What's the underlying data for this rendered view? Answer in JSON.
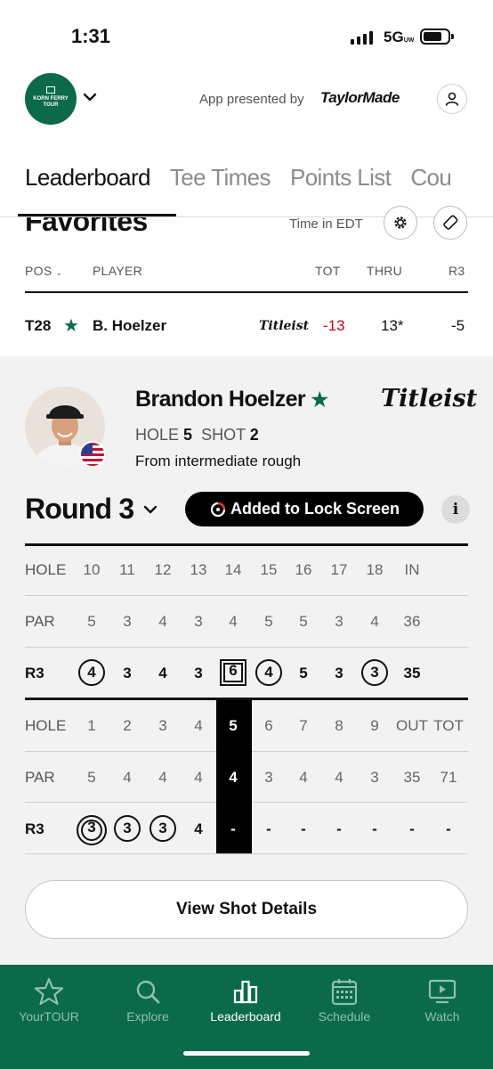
{
  "status_bar": {
    "time": "1:31",
    "network": "5G",
    "network_sub": "UW"
  },
  "header": {
    "logo_lines": [
      "KORN FERRY",
      "TOUR"
    ],
    "presented_by": "App presented by",
    "brand": "TaylorMade"
  },
  "tabs": [
    {
      "label": "Leaderboard",
      "active": true
    },
    {
      "label": "Tee Times",
      "active": false
    },
    {
      "label": "Points List",
      "active": false
    },
    {
      "label": "Cou",
      "active": false
    }
  ],
  "favorites": {
    "title": "Favorites",
    "time_zone": "Time in EDT",
    "columns": {
      "pos": "POS",
      "player": "PLAYER",
      "tot": "TOT",
      "thru": "THRU",
      "round": "R3"
    },
    "row": {
      "pos": "T28",
      "player": "B. Hoelzer",
      "sponsor": "Titleist",
      "tot": "-13",
      "thru": "13*",
      "round": "-5"
    }
  },
  "player": {
    "name": "Brandon Hoelzer",
    "sponsor": "Titleist",
    "hole_label": "HOLE",
    "hole": "5",
    "shot_label": "SHOT",
    "shot": "2",
    "lie": "From intermediate rough"
  },
  "round": {
    "label": "Round 3",
    "lock_button": "Added to Lock Screen",
    "info": "i"
  },
  "scorecard": {
    "back": {
      "hole": [
        "HOLE",
        "10",
        "11",
        "12",
        "13",
        "14",
        "15",
        "16",
        "17",
        "18",
        "IN"
      ],
      "par": [
        "PAR",
        "5",
        "3",
        "4",
        "3",
        "4",
        "5",
        "5",
        "3",
        "4",
        "36"
      ],
      "score": [
        "R3",
        "4",
        "3",
        "4",
        "3",
        "6",
        "4",
        "5",
        "3",
        "3",
        "35"
      ]
    },
    "front": {
      "hole": [
        "HOLE",
        "1",
        "2",
        "3",
        "4",
        "5",
        "6",
        "7",
        "8",
        "9",
        "OUT",
        "TOT"
      ],
      "par": [
        "PAR",
        "5",
        "4",
        "4",
        "4",
        "4",
        "3",
        "4",
        "4",
        "3",
        "35",
        "71"
      ],
      "score": [
        "R3",
        "3",
        "3",
        "3",
        "4",
        "-",
        "-",
        "-",
        "-",
        "-",
        "-",
        "-"
      ]
    }
  },
  "shot_details_button": "View Shot Details",
  "bottom_nav": [
    {
      "label": "YourTOUR",
      "icon": "star-icon",
      "active": false
    },
    {
      "label": "Explore",
      "icon": "search-icon",
      "active": false
    },
    {
      "label": "Leaderboard",
      "icon": "leaderboard-icon",
      "active": true
    },
    {
      "label": "Schedule",
      "icon": "calendar-icon",
      "active": false
    },
    {
      "label": "Watch",
      "icon": "play-icon",
      "active": false
    }
  ],
  "colors": {
    "brand_green": "#0b6a4a",
    "under_par_red": "#d0021b",
    "nav_inactive": "#8ec0ad"
  }
}
